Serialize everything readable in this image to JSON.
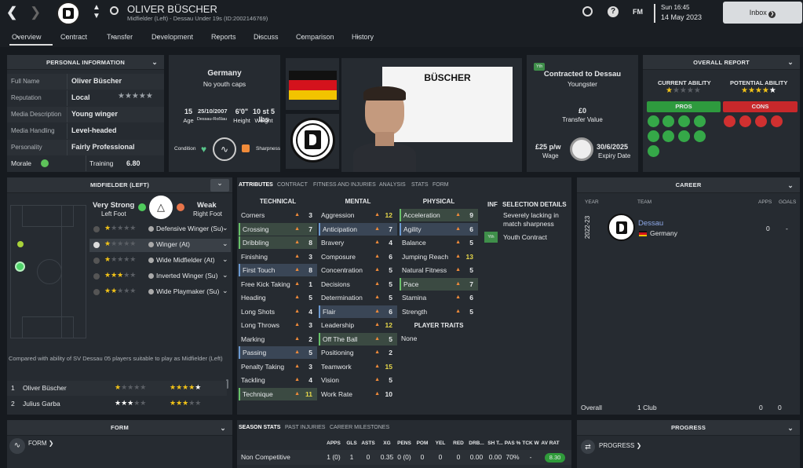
{
  "header": {
    "name": "OLIVER BÜSCHER",
    "subtitle": "Midfielder (Left) - Dessau Under 19s (ID:2002146769)",
    "time": "Sun 16:45",
    "date": "14 May 2023",
    "fm": "FM",
    "inbox": "Inbox"
  },
  "tabs": [
    "Overview",
    "Contract",
    "Transfer",
    "Development",
    "Reports",
    "Discuss",
    "Comparison",
    "History"
  ],
  "personal": {
    "title": "PERSONAL INFORMATION",
    "rows": [
      {
        "k": "Full Name",
        "v": "Oliver Büscher"
      },
      {
        "k": "Reputation",
        "v": "Local"
      },
      {
        "k": "Media Description",
        "v": "Young winger"
      },
      {
        "k": "Media Handling",
        "v": "Level-headed"
      },
      {
        "k": "Personality",
        "v": "Fairly Professional"
      }
    ],
    "morale": "Morale",
    "training": "Training",
    "training_val": "6.80"
  },
  "nation": {
    "country": "Germany",
    "caps": "No youth caps",
    "age": "15",
    "age_l": "Age",
    "dob": "25/10/2007",
    "dob_l": "Dessau-Roßlau",
    "height": "6'0\"",
    "height_l": "Height",
    "weight": "10 st 5 lbs",
    "weight_l": "Weight",
    "condition": "Condition",
    "sharpness": "Sharpness"
  },
  "player_card": {
    "name": "BÜSCHER"
  },
  "contract": {
    "yth": "Yth",
    "title": "Contracted to Dessau",
    "sub": "Youngster",
    "value": "£0",
    "value_l": "Transfer Value",
    "wage": "£25 p/w",
    "wage_l": "Wage",
    "expiry": "30/6/2025",
    "expiry_l": "Expiry Date"
  },
  "report": {
    "title": "OVERALL REPORT",
    "ca": "CURRENT ABILITY",
    "pa": "POTENTIAL ABILITY",
    "pros": "PROS",
    "cons": "CONS",
    "colors": {
      "pro": "#2e9a3e",
      "con": "#c8282b"
    }
  },
  "position": {
    "title": "MIDFIELDER (LEFT)",
    "strong": "Very Strong",
    "strong_l": "Left Foot",
    "weak": "Weak",
    "weak_l": "Right Foot",
    "roles": [
      "Defensive Winger (Su)",
      "Winger (At)",
      "Wide Midfielder (At)",
      "Inverted Winger (Su)",
      "Wide Playmaker (Su)"
    ],
    "compare": "Compared with ability of SV Dessau 05 players suitable to play as Midfielder (Left)",
    "list": [
      {
        "n": "1",
        "name": "Oliver Büscher"
      },
      {
        "n": "2",
        "name": "Julius Garba"
      }
    ]
  },
  "attr_tabs": [
    "ATTRIBUTES",
    "CONTRACT",
    "FITNESS AND INJURIES",
    "ANALYSIS",
    "STATS",
    "FORM"
  ],
  "technical": {
    "title": "TECHNICAL",
    "items": [
      {
        "n": "Corners",
        "v": "3"
      },
      {
        "n": "Crossing",
        "v": "7",
        "h": "g"
      },
      {
        "n": "Dribbling",
        "v": "8",
        "h": "g"
      },
      {
        "n": "Finishing",
        "v": "3"
      },
      {
        "n": "First Touch",
        "v": "8",
        "h": "b"
      },
      {
        "n": "Free Kick Taking",
        "v": "1"
      },
      {
        "n": "Heading",
        "v": "5"
      },
      {
        "n": "Long Shots",
        "v": "4"
      },
      {
        "n": "Long Throws",
        "v": "3"
      },
      {
        "n": "Marking",
        "v": "2"
      },
      {
        "n": "Passing",
        "v": "5",
        "h": "b"
      },
      {
        "n": "Penalty Taking",
        "v": "3"
      },
      {
        "n": "Tackling",
        "v": "4"
      },
      {
        "n": "Technique",
        "v": "11",
        "h": "g"
      }
    ]
  },
  "mental": {
    "title": "MENTAL",
    "items": [
      {
        "n": "Aggression",
        "v": "12"
      },
      {
        "n": "Anticipation",
        "v": "7",
        "h": "b"
      },
      {
        "n": "Bravery",
        "v": "4"
      },
      {
        "n": "Composure",
        "v": "6"
      },
      {
        "n": "Concentration",
        "v": "5"
      },
      {
        "n": "Decisions",
        "v": "5"
      },
      {
        "n": "Determination",
        "v": "5"
      },
      {
        "n": "Flair",
        "v": "6",
        "h": "b"
      },
      {
        "n": "Leadership",
        "v": "12"
      },
      {
        "n": "Off The Ball",
        "v": "5",
        "h": "g"
      },
      {
        "n": "Positioning",
        "v": "2"
      },
      {
        "n": "Teamwork",
        "v": "15"
      },
      {
        "n": "Vision",
        "v": "5"
      },
      {
        "n": "Work Rate",
        "v": "10"
      }
    ]
  },
  "physical": {
    "title": "PHYSICAL",
    "items": [
      {
        "n": "Acceleration",
        "v": "9",
        "h": "g"
      },
      {
        "n": "Agility",
        "v": "6",
        "h": "b"
      },
      {
        "n": "Balance",
        "v": "5"
      },
      {
        "n": "Jumping Reach",
        "v": "13"
      },
      {
        "n": "Natural Fitness",
        "v": "5"
      },
      {
        "n": "Pace",
        "v": "7",
        "h": "g"
      },
      {
        "n": "Stamina",
        "v": "6"
      },
      {
        "n": "Strength",
        "v": "5"
      }
    ]
  },
  "traits": {
    "title": "PLAYER TRAITS",
    "none": "None"
  },
  "selection": {
    "inf": "INF",
    "title": "SELECTION DETAILS",
    "line1": "Severely lacking in match sharpness",
    "yth": "Yth",
    "line2": "Youth Contract"
  },
  "career": {
    "title": "CAREER",
    "year": "YEAR",
    "team": "TEAM",
    "apps": "APPS",
    "goals": "GOALS",
    "season": "2022-23",
    "club": "Dessau",
    "country": "Germany",
    "c_apps": "0",
    "c_goals": "-",
    "overall": "Overall",
    "clubs": "1 Club",
    "o_apps": "0",
    "o_goals": "0"
  },
  "form": {
    "title": "FORM",
    "link": "FORM"
  },
  "season": {
    "tabs": [
      "SEASON STATS",
      "PAST INJURIES",
      "CAREER MILESTONES"
    ],
    "cols": [
      "APPS",
      "GLS",
      "ASTS",
      "XG",
      "PENS",
      "POM",
      "YEL",
      "RED",
      "DRB...",
      "SH T...",
      "PAS %",
      "TCK W",
      "AV RAT"
    ],
    "row_label": "Non Competitive",
    "vals": [
      "1 (0)",
      "1",
      "0",
      "0.35",
      "0 (0)",
      "0",
      "0",
      "0",
      "0.00",
      "0.00",
      "70%",
      "-",
      "8.30"
    ]
  },
  "progress": {
    "title": "PROGRESS",
    "link": "PROGRESS"
  }
}
